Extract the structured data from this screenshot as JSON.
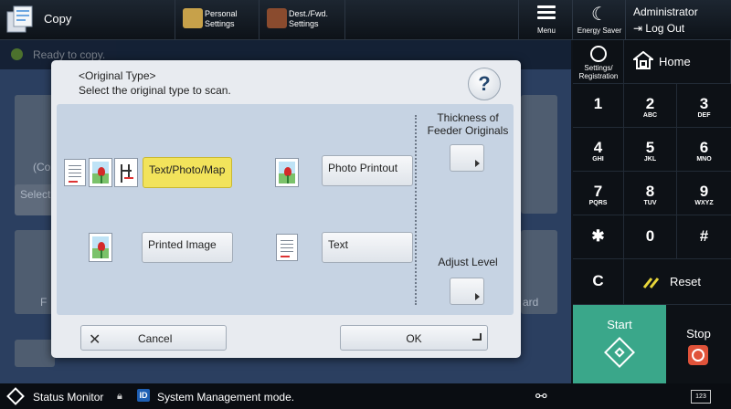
{
  "topbar": {
    "copy_label": "Copy",
    "personal_settings": [
      "Personal",
      "Settings"
    ],
    "dest_fwd_settings": [
      "Dest./Fwd.",
      "Settings"
    ],
    "menu_label": "Menu",
    "energy_saver_label": "Energy Saver",
    "user_name": "Administrator",
    "logout_label": "Log Out"
  },
  "status": {
    "text": "Ready to copy."
  },
  "background": {
    "partial_texts": [
      "(Co",
      "Select",
      "F",
      "ard"
    ]
  },
  "dialog": {
    "title": "<Original Type>",
    "subtitle": "Select the original type to scan.",
    "help_label": "?",
    "options": [
      {
        "label": "Text/Photo/Map",
        "selected": true
      },
      {
        "label": "Photo Printout",
        "selected": false
      },
      {
        "label": "Printed Image",
        "selected": false
      },
      {
        "label": "Text",
        "selected": false
      }
    ],
    "thickness_label": [
      "Thickness of",
      "Feeder Originals"
    ],
    "adjust_level_label": "Adjust Level",
    "cancel_label": "Cancel",
    "ok_label": "OK",
    "selected_color": "#f2e35b"
  },
  "keypad": {
    "settings_registration": [
      "Settings/",
      "Registration"
    ],
    "home_label": "Home",
    "keys": [
      {
        "num": "1",
        "sub": ""
      },
      {
        "num": "2",
        "sub": "ABC"
      },
      {
        "num": "3",
        "sub": "DEF"
      },
      {
        "num": "4",
        "sub": "GHI"
      },
      {
        "num": "5",
        "sub": "JKL"
      },
      {
        "num": "6",
        "sub": "MNO"
      },
      {
        "num": "7",
        "sub": "PQRS"
      },
      {
        "num": "8",
        "sub": "TUV"
      },
      {
        "num": "9",
        "sub": "WXYZ"
      },
      {
        "num": "✱",
        "sub": ""
      },
      {
        "num": "0",
        "sub": ""
      },
      {
        "num": "#",
        "sub": ""
      }
    ],
    "clear_label": "C",
    "reset_label": "Reset",
    "start_label": "Start",
    "stop_label": "Stop",
    "start_color": "#3aa78a",
    "stop_color": "#e0533a"
  },
  "bottombar": {
    "status_monitor_label": "Status Monitor",
    "id_badge": "ID",
    "system_mode_text": "System Management mode.",
    "keyboard_label": "123"
  }
}
